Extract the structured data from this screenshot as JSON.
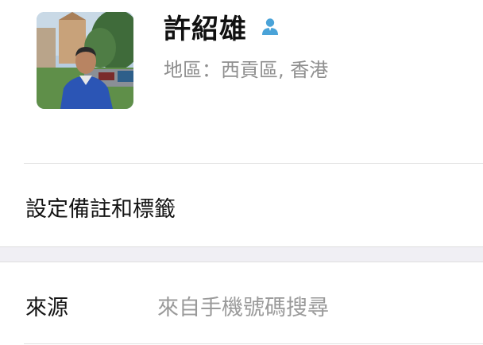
{
  "profile": {
    "name": "許紹雄",
    "region_label": "地區：",
    "region_value": "西貢區, 香港",
    "verified_icon": "person-icon",
    "accent_color": "#4aa3d8"
  },
  "rows": {
    "remark": {
      "label": "設定備註和標籤"
    },
    "source": {
      "label": "來源",
      "value": "來自手機號碼搜尋"
    }
  }
}
